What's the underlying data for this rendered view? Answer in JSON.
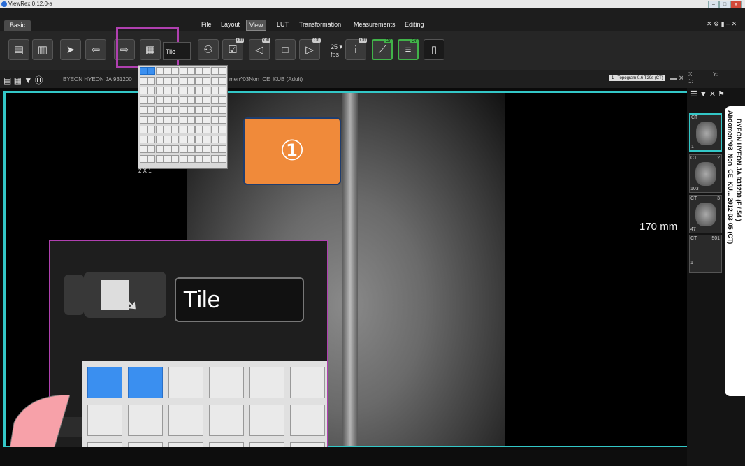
{
  "window": {
    "title": "ViewRex 0.12.0-a"
  },
  "menubar": {
    "tab_basic": "Basic",
    "items": [
      "File",
      "Layout",
      "View",
      "LUT",
      "Transformation",
      "Measurements",
      "Editing"
    ],
    "active": "View"
  },
  "toolbar": {
    "tile_label": "Tile",
    "fps_value": "25",
    "fps_unit": "fps",
    "off_label": "Off",
    "on_label": "On"
  },
  "infobar": {
    "patient_text": "BYEON HYEON JA 931200",
    "study_fragment": "men^03Non_CE_KUB (Adult)",
    "series_select": "1 - Topogram 0.6 T20s (CT)",
    "x_label": "X:",
    "y_label": "Y:",
    "x_value": "1:"
  },
  "tilegrid": {
    "rows": 10,
    "cols": 11,
    "selected_cols": 2,
    "size_label": "2 X 1"
  },
  "callout": {
    "number": "①"
  },
  "viewer": {
    "scale_label": "170 mm"
  },
  "zoom": {
    "tile_label": "Tile"
  },
  "series": [
    {
      "modality": "CT",
      "number": "2",
      "count": "103"
    },
    {
      "modality": "CT",
      "number": "3",
      "count": "47"
    },
    {
      "modality": "CT",
      "number": "501",
      "count": "1"
    }
  ],
  "selected_series": {
    "modality": "CT",
    "count": "1"
  },
  "patient_panel": {
    "line1": "BYEON HYEON JA 931200 (F / 54 )",
    "line2": "Abdomen^03_Non_CE_KU... 2012-03-05 (CT)"
  },
  "colors": {
    "accent_cyan": "#33c7c7",
    "highlight_purple": "#b040b0",
    "callout_orange": "#f08a3a",
    "selection_blue": "#3a8ff0",
    "toggle_green": "#41b349"
  }
}
